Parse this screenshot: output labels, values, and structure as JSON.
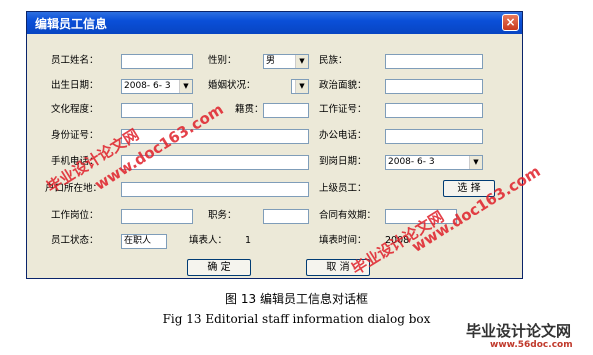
{
  "window": {
    "title": "编辑员工信息",
    "close_glyph": "×"
  },
  "labels": {
    "name": "员工姓名：",
    "gender": "性别：",
    "nation": "民族：",
    "birthdate": "出生日期：",
    "marital": "婚姻状况：",
    "political": "政治面貌：",
    "education": "文化程度：",
    "native": "籍贯：",
    "work_id": "工作证号：",
    "id_card": "身份证号：",
    "office_phone": "办公电话：",
    "mobile": "手机电话：",
    "join_date": "到岗日期：",
    "address": "户口所在地：",
    "superior": "上级员工：",
    "position": "工作岗位：",
    "duty": "职务：",
    "contract": "合同有效期：",
    "status": "员工状态：",
    "filler": "填表人：",
    "filler_value": "1",
    "fill_time": "填表时间：",
    "fill_time_value": "2008"
  },
  "fields": {
    "gender_value": "男",
    "birthdate_value": "2008- 6- 3",
    "join_date_value": "2008- 6- 3",
    "status_value": "在职人"
  },
  "buttons": {
    "select": "选 择",
    "ok": "确 定",
    "cancel": "取 消"
  },
  "caption": {
    "zh": "图 13  编辑员工信息对话框",
    "en": "Fig 13 Editorial staff information dialog box"
  },
  "watermark": {
    "text1": "毕业设计论文网",
    "url1": "www.doc163.com",
    "logo": "毕业设计论文网",
    "logo_url": "www.56doc.com"
  },
  "colors": {
    "titlebar": "#0a4fd8",
    "dialog_bg": "#ece9d8",
    "watermark": "#e0202a"
  }
}
